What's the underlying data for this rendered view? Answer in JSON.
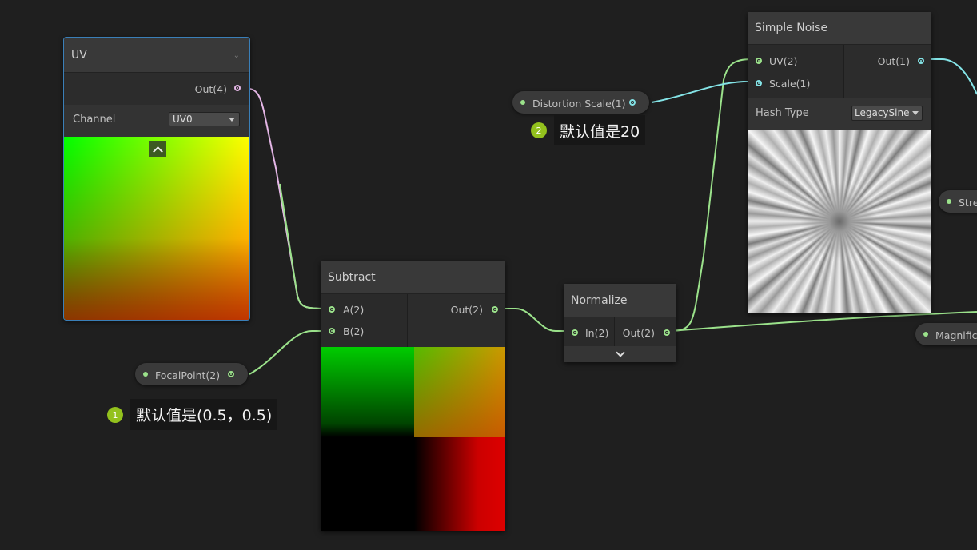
{
  "uv_node": {
    "title": "UV",
    "out_label": "Out(4)",
    "channel_label": "Channel",
    "channel_value": "UV0"
  },
  "subtract_node": {
    "title": "Subtract",
    "in_a": "A(2)",
    "in_b": "B(2)",
    "out": "Out(2)"
  },
  "normalize_node": {
    "title": "Normalize",
    "in": "In(2)",
    "out": "Out(2)"
  },
  "noise_node": {
    "title": "Simple Noise",
    "in_uv": "UV(2)",
    "in_scale": "Scale(1)",
    "out": "Out(1)",
    "hash_label": "Hash Type",
    "hash_value": "LegacySine"
  },
  "props": {
    "distortion": "Distortion Scale(1)",
    "focal": "FocalPoint(2)",
    "strength": "Stre",
    "magnitude": "Magnific"
  },
  "notes": [
    {
      "badge": "2",
      "text": "默认值是20"
    },
    {
      "badge": "1",
      "text": "默认值是(0.5，0.5)"
    }
  ],
  "colors": {
    "wire_green": "#9be28b",
    "wire_pink": "#e5b7e7",
    "wire_cyan": "#84e4e7",
    "badge": "#93c11d",
    "selected_border": "#3a7fb8"
  }
}
